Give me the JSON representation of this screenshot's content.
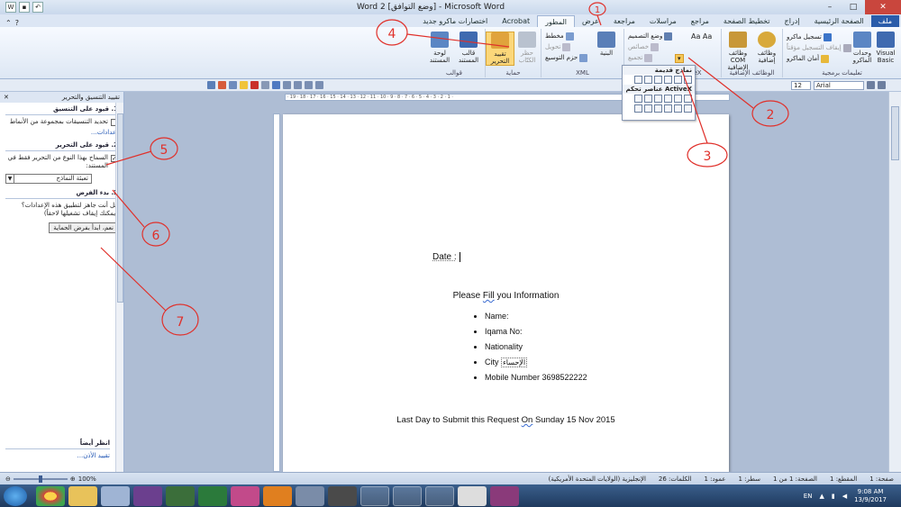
{
  "window": {
    "title": "Word 2 [وضع التوافق] - Microsoft Word",
    "minimize": "–",
    "maximize": "□",
    "close": "✕"
  },
  "tabs": [
    {
      "label": "ملف",
      "active": false
    },
    {
      "label": "الصفحة الرئيسية",
      "active": false
    },
    {
      "label": "إدراج",
      "active": false
    },
    {
      "label": "تخطيط الصفحة",
      "active": false
    },
    {
      "label": "مراجع",
      "active": false
    },
    {
      "label": "مراسلات",
      "active": false
    },
    {
      "label": "مراجعة",
      "active": false
    },
    {
      "label": "عرض",
      "active": false
    },
    {
      "label": "المطور",
      "active": true
    },
    {
      "label": "Acrobat",
      "active": false
    },
    {
      "label": "اختصارات ماكرو جديد",
      "active": false
    }
  ],
  "ribbon": {
    "code_group": {
      "name": "تعليمات برمجية",
      "visual_basic": "Visual Basic",
      "macros": "وحدات الماكرو",
      "record_macro": "تسجيل ماكرو",
      "pause_recording": "إيقاف التسجيل مؤقتاً",
      "macro_security": "أمان الماكرو"
    },
    "addins_group": {
      "name": "الوظائف الإضافية",
      "addins": "وظائف إضافية",
      "com_addins": "وظائف COM الإضافية"
    },
    "controls_group": {
      "name": "عناصر تحكم",
      "design_mode": "وضع التصميم",
      "properties": "خصائص",
      "group": "تجميع"
    },
    "xml_group": {
      "name": "XML",
      "structure": "البنية",
      "schema": "مخطط",
      "transform": "تحويل",
      "expansion_packs": "حزم التوسيع"
    },
    "protect_group": {
      "name": "حماية",
      "block_authors": "حظر الكتّاب",
      "restrict_editing": "تقييد التحرير"
    },
    "templates_group": {
      "name": "قوالب",
      "document_template": "قالب المستند",
      "document_panel": "لوحة المستند"
    }
  },
  "controls_popup": {
    "legacy_header": "نماذج قديمة",
    "activex_header": "عناصر تحكم ActiveX"
  },
  "format_bar": {
    "font": "Arial",
    "size": "12"
  },
  "task_pane": {
    "title": "تقييد التنسيق والتحرير",
    "close": "✕",
    "section1_title": "1. قيود على التنسيق",
    "section1_option": "تحديد التنسيقات بمجموعة من الأنماط",
    "section1_settings": "إعدادات...",
    "section2_title": "2. قيود على التحرير",
    "section2_option": "السماح بهذا النوع من التحرير فقط في المستند:",
    "section2_dropdown": "تعبئة النماذج",
    "section3_title": "3. بدء الفرض",
    "section3_question": "هل أنت جاهز لتطبيق هذه الإعدادات؟ (يمكنك إيقاف تشغيلها لاحقاً)",
    "section3_button": "نعم، ابدأ بفرض الحماية",
    "see_also": "انظر أيضاً",
    "restrict_permission": "تقييد الأذن..."
  },
  "document": {
    "date_label": "Date :",
    "heading_pre": "Please ",
    "heading_fill": "Fill",
    "heading_post": " you Information",
    "items": {
      "name": "Name:",
      "iqama": "Iqama  No:",
      "nationality": "Nationality",
      "city": "City",
      "city_tag": "الإحساء",
      "mobile": "Mobile Number 3698522222"
    },
    "deadline_pre": "Last Day to Submit this Request ",
    "deadline_on": "On",
    "deadline_post": " Sunday 15 Nov 2015"
  },
  "status_bar": {
    "zoom": "100%",
    "page": "صفحة: 1",
    "section": "المقطع: 1",
    "page_of": "الصفحة: 1 من 1",
    "line": "سطر: 1",
    "column": "عمود: 1",
    "words": "الكلمات: 26",
    "language": "الإنجليزية (الولايات المتحدة الأمريكية)"
  },
  "taskbar": {
    "lang": "EN",
    "time": "9:08 AM",
    "date": "13/9/2017"
  },
  "annotations": [
    "1",
    "2",
    "3",
    "4",
    "5",
    "6",
    "7"
  ],
  "colors": {
    "file_tab": "#2a5caa",
    "ribbon_bg": "#dde7f4",
    "workspace": "#aebdd4",
    "annotation_ink": "#e0302a"
  }
}
